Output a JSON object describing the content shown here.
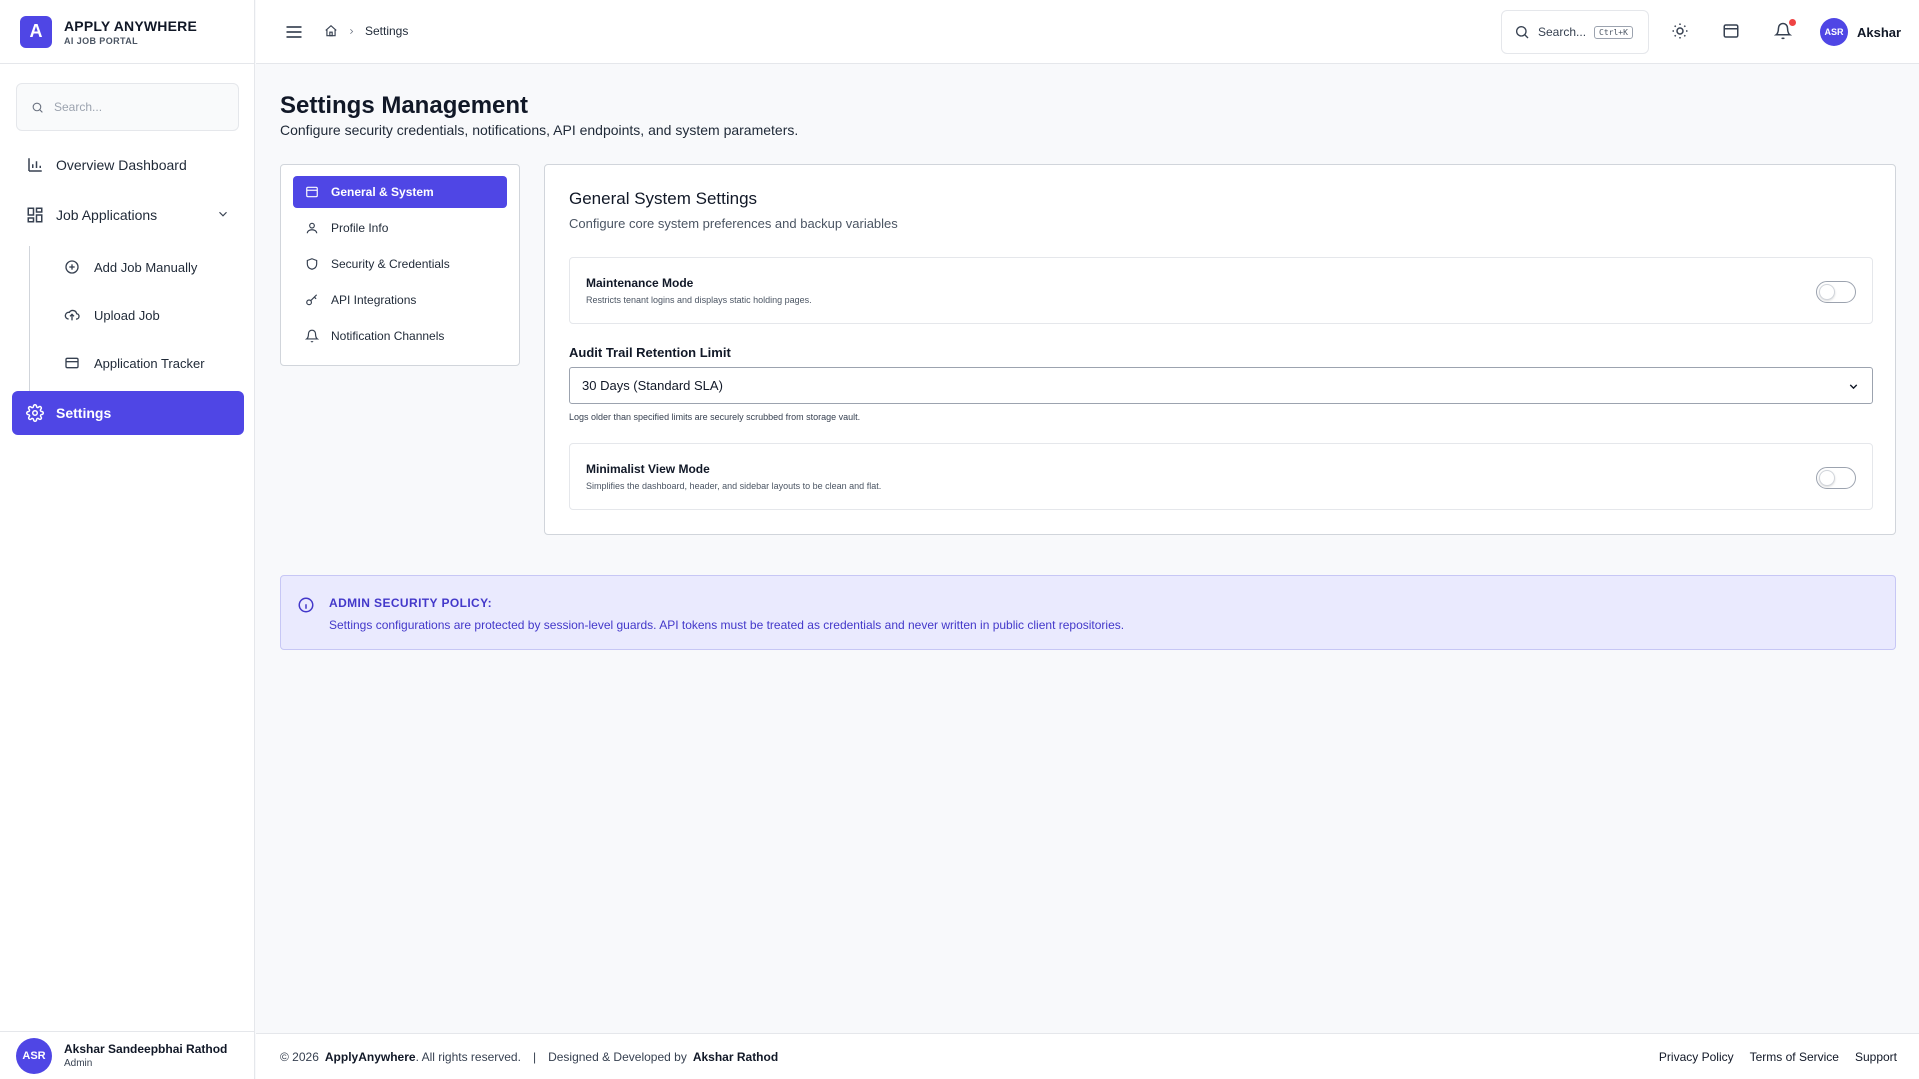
{
  "brand": {
    "logo_letter": "A",
    "title": "APPLY ANYWHERE",
    "subtitle": "AI JOB PORTAL"
  },
  "sidebar": {
    "search_placeholder": "Search...",
    "items": [
      {
        "label": "Overview Dashboard",
        "icon": "bar-chart-icon"
      },
      {
        "label": "Job Applications",
        "icon": "grid-icon",
        "expanded": true
      },
      {
        "label": "Settings",
        "icon": "gear-icon",
        "active": true
      }
    ],
    "sub_items": [
      {
        "label": "Add Job Manually",
        "icon": "plus-circle-icon"
      },
      {
        "label": "Upload Job",
        "icon": "cloud-upload-icon"
      },
      {
        "label": "Application Tracker",
        "icon": "card-icon"
      }
    ],
    "user": {
      "initials": "ASR",
      "name": "Akshar Sandeepbhai Rathod",
      "role": "Admin"
    }
  },
  "topbar": {
    "breadcrumb": [
      "Settings"
    ],
    "search_label": "Search...",
    "search_shortcut": "Ctrl+K",
    "user_initials": "ASR",
    "user_name": "Akshar"
  },
  "page": {
    "title": "Settings Management",
    "subtitle": "Configure security credentials, notifications, API endpoints, and system parameters."
  },
  "tabs": [
    {
      "label": "General & System",
      "icon": "window-icon",
      "active": true
    },
    {
      "label": "Profile Info",
      "icon": "user-icon"
    },
    {
      "label": "Security & Credentials",
      "icon": "shield-icon"
    },
    {
      "label": "API Integrations",
      "icon": "key-icon"
    },
    {
      "label": "Notification Channels",
      "icon": "bell-icon"
    }
  ],
  "general": {
    "title": "General System Settings",
    "subtitle": "Configure core system preferences and backup variables",
    "maintenance": {
      "label": "Maintenance Mode",
      "description": "Restricts tenant logins and displays static holding pages.",
      "enabled": false
    },
    "audit": {
      "label": "Audit Trail Retention Limit",
      "value": "30 Days (Standard SLA)",
      "help": "Logs older than specified limits are securely scrubbed from storage vault."
    },
    "minimalist": {
      "label": "Minimalist View Mode",
      "description": "Simplifies the dashboard, header, and sidebar layouts to be clean and flat.",
      "enabled": false
    }
  },
  "policy": {
    "title": "ADMIN SECURITY POLICY:",
    "text": "Settings configurations are protected by session-level guards. API tokens must be treated as credentials and never written in public client repositories."
  },
  "footer": {
    "copyright_prefix": "© 2026",
    "brand": "ApplyAnywhere",
    "rights": ". All rights reserved.",
    "separator": "|",
    "designed_prefix": "Designed & Developed by",
    "designer": "Akshar Rathod",
    "links": [
      "Privacy Policy",
      "Terms of Service",
      "Support"
    ]
  },
  "colors": {
    "accent": "#4f46e5",
    "policy_bg": "#eaeafe",
    "notification_dot": "#ef4444"
  }
}
